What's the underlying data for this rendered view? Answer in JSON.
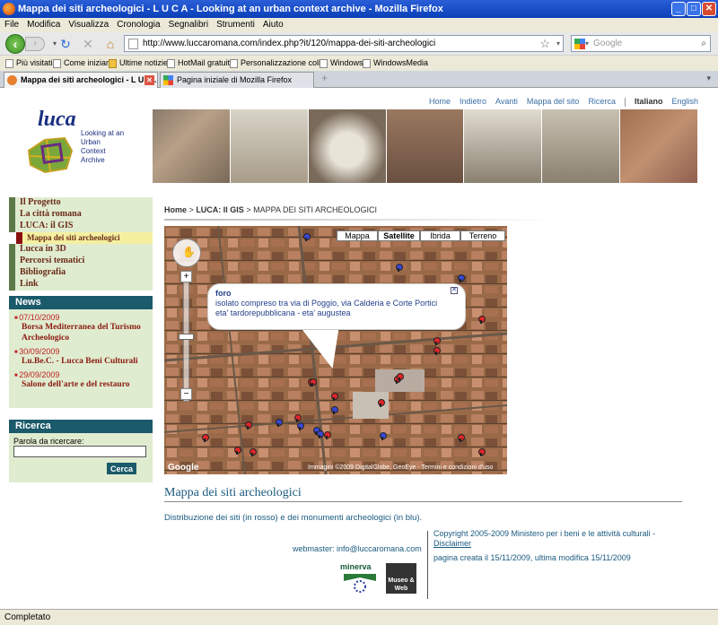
{
  "window": {
    "title": "Mappa dei siti archeologici - L U C A - Looking at an urban context archive - Mozilla Firefox"
  },
  "menubar": [
    "File",
    "Modifica",
    "Visualizza",
    "Cronologia",
    "Segnalibri",
    "Strumenti",
    "Aiuto"
  ],
  "navbar": {
    "url": "http://www.luccaromana.com/index.php?it/120/mappa-dei-siti-archeologici",
    "search_placeholder": "Google"
  },
  "bookmarks": [
    "Più visitati",
    "Come iniziare",
    "Ultime notizie",
    "HotMail gratuita",
    "Personalizzazione coll...",
    "Windows",
    "WindowsMedia"
  ],
  "tabs": [
    {
      "label": "Mappa dei siti archeologici - L U C..."
    },
    {
      "label": "Pagina iniziale di Mozilla Firefox"
    }
  ],
  "status": "Completato",
  "site": {
    "topnav": [
      "Home",
      "Indietro",
      "Avanti",
      "Mappa del sito",
      "Ricerca"
    ],
    "lang_active": "Italiano",
    "lang_other": "English",
    "logo_text": "luca",
    "logo_subtitle": "Looking at an Urban Context Archive",
    "menu": [
      "Il Progetto",
      "La città romana",
      "LUCA: il GIS",
      "Mappa dei siti archeologici",
      "Lucca in 3D",
      "Percorsi tematici",
      "Bibliografia",
      "Link"
    ],
    "news_title": "News",
    "news": [
      {
        "date": "07/10/2009",
        "title": "Borsa Mediterranea del Turismo Archeologico"
      },
      {
        "date": "30/09/2009",
        "title": "Lu.Be.C. - Lucca Beni Culturali"
      },
      {
        "date": "29/09/2009",
        "title": "Salone dell'arte e del restauro"
      }
    ],
    "search_title": "Ricerca",
    "search_label": "Parola da ricercare:",
    "search_button": "Cerca",
    "breadcrumb": {
      "home": "Home",
      "sep": ">",
      "gis": "LUCA: Il GIS",
      "current": "MAPPA DEI SITI ARCHEOLOGICI"
    },
    "map_types": [
      "Mappa",
      "Satellite",
      "Ibrida",
      "Terreno"
    ],
    "map_type_selected": "Satellite",
    "popup": {
      "title": "foro",
      "line1": "isolato compreso tra via di Poggio, via Calderia e Corte Portici",
      "line2": "eta' tardorepubblicana - eta' augustea"
    },
    "map_copyright": "Immagini ©2009 DigitalGlobe, GeoEye - Termini e condizioni d'uso",
    "map_logo": "Google",
    "page_title": "Mappa dei siti archeologici",
    "page_desc": "Distribuzione dei siti (in rosso) e dei monumenti archeologici (in blu).",
    "webmaster": "webmaster: info@luccaromana.com",
    "copyright": "Copyright 2005-2009 Ministero per i beni e le attività culturali -",
    "disclaimer": "Disclaimer",
    "page_dates": "pagina creata il 15/11/2009, ultima modifica 15/11/2009",
    "minerva_label": "minerva",
    "museo_label": "Museo & Web"
  },
  "colors": {
    "site_pin": "#e0262a",
    "monument_pin": "#3a48d8",
    "panel_header": "#1a5a6a",
    "menu_text": "#6a2a18"
  }
}
